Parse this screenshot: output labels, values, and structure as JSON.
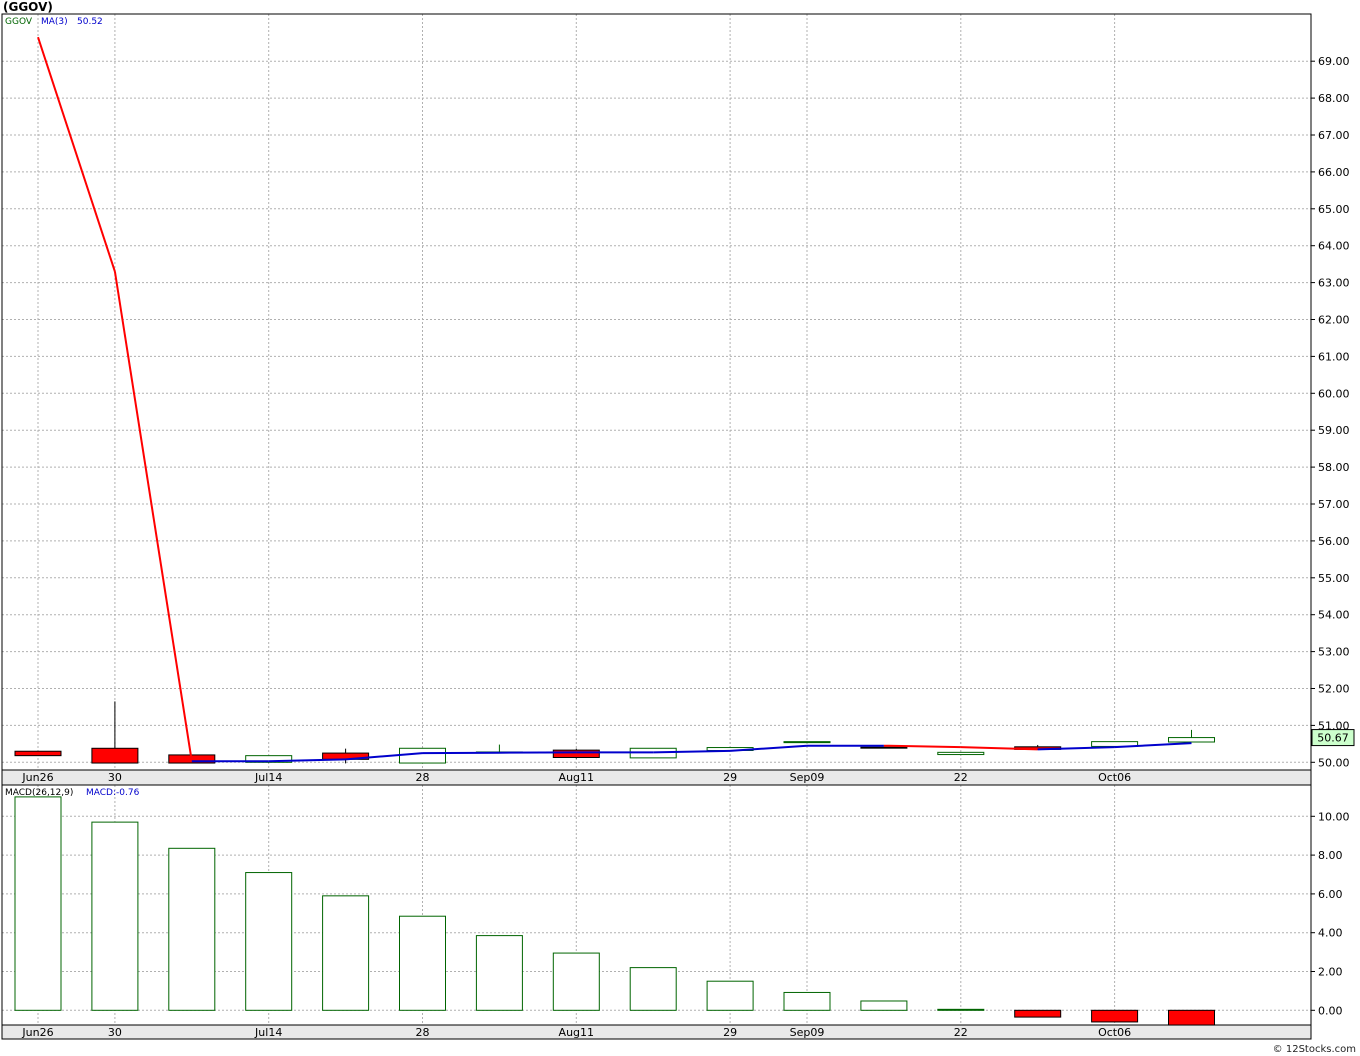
{
  "title": "(GGOV)",
  "credit": "© 12Stocks.com",
  "colors": {
    "up": "#006400",
    "down": "#ff0000",
    "ma_down": "#ff0000",
    "ma_up": "#0000cc",
    "grid": "#b0b0b0",
    "last_price_bg": "#ccffcc"
  },
  "chart_data": [
    {
      "type": "candlestick",
      "legend": {
        "symbol": "GGOV",
        "ma_label": "MA(3)",
        "ma_value": "50.52"
      },
      "last_price_label": "50.67",
      "x_tick_labels": [
        "Jun26",
        "30",
        "Jul14",
        "28",
        "Aug11",
        "29",
        "Sep09",
        "22",
        "Oct06"
      ],
      "x_tick_index": [
        0,
        1,
        3,
        5,
        7,
        9,
        10,
        12,
        14
      ],
      "ylim": [
        49.75,
        70.1
      ],
      "y_ticks": [
        "50.00",
        "51.00",
        "52.00",
        "53.00",
        "54.00",
        "55.00",
        "56.00",
        "57.00",
        "58.00",
        "59.00",
        "60.00",
        "61.00",
        "62.00",
        "63.00",
        "64.00",
        "65.00",
        "66.00",
        "67.00",
        "68.00",
        "69.00"
      ],
      "candles": [
        {
          "o": 50.3,
          "h": 50.3,
          "l": 50.18,
          "c": 50.18
        },
        {
          "o": 50.38,
          "h": 51.65,
          "l": 49.98,
          "c": 49.98
        },
        {
          "o": 50.2,
          "h": 50.2,
          "l": 49.98,
          "c": 49.98
        },
        {
          "o": 50.0,
          "h": 50.18,
          "l": 49.98,
          "c": 50.18
        },
        {
          "o": 50.25,
          "h": 50.37,
          "l": 49.97,
          "c": 50.08
        },
        {
          "o": 49.98,
          "h": 50.38,
          "l": 49.98,
          "c": 50.38
        },
        {
          "o": 50.28,
          "h": 50.48,
          "l": 50.28,
          "c": 50.28
        },
        {
          "o": 50.33,
          "h": 50.37,
          "l": 50.1,
          "c": 50.13
        },
        {
          "o": 50.12,
          "h": 50.38,
          "l": 50.12,
          "c": 50.38
        },
        {
          "o": 50.32,
          "h": 50.4,
          "l": 50.32,
          "c": 50.4
        },
        {
          "o": 50.55,
          "h": 50.56,
          "l": 50.55,
          "c": 50.56
        },
        {
          "o": 50.41,
          "h": 50.41,
          "l": 50.4,
          "c": 50.4
        },
        {
          "o": 50.21,
          "h": 50.27,
          "l": 50.21,
          "c": 50.27
        },
        {
          "o": 50.42,
          "h": 50.47,
          "l": 50.35,
          "c": 50.35
        },
        {
          "o": 50.43,
          "h": 50.56,
          "l": 50.43,
          "c": 50.56
        },
        {
          "o": 50.55,
          "h": 50.88,
          "l": 50.55,
          "c": 50.67
        }
      ],
      "ma_values": [
        69.65,
        63.3,
        50.03,
        50.03,
        50.08,
        50.25,
        50.26,
        50.27,
        50.27,
        50.31,
        50.45,
        50.45,
        50.41,
        50.35,
        50.41,
        50.52
      ]
    },
    {
      "type": "bar",
      "legend": {
        "name": "MACD(26,12,9)",
        "value_label": "MACD:-0.76"
      },
      "x_tick_labels": [
        "Jun26",
        "30",
        "Jul14",
        "28",
        "Aug11",
        "29",
        "Sep09",
        "22",
        "Oct06"
      ],
      "x_tick_index": [
        0,
        1,
        3,
        5,
        7,
        9,
        10,
        12,
        14
      ],
      "ylim": [
        -0.75,
        11.2
      ],
      "y_ticks": [
        "0.00",
        "2.00",
        "4.00",
        "6.00",
        "8.00",
        "10.00"
      ],
      "values": [
        11.0,
        9.7,
        8.35,
        7.1,
        5.9,
        4.85,
        3.85,
        2.95,
        2.2,
        1.5,
        0.92,
        0.48,
        0.05,
        -0.35,
        -0.6,
        -0.76
      ]
    }
  ]
}
